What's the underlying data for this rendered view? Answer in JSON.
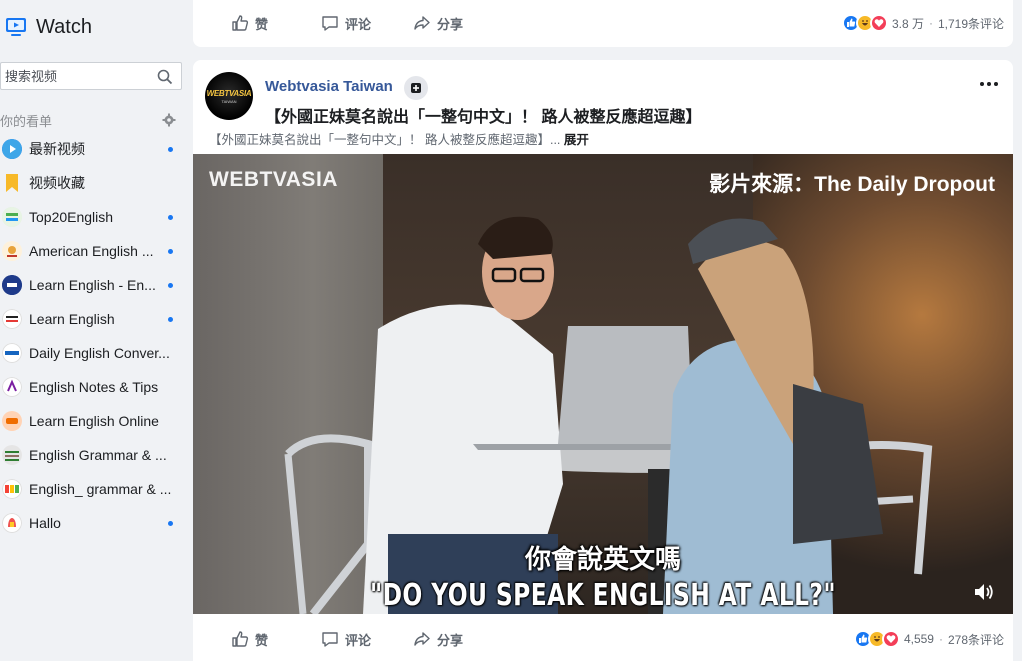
{
  "sidebar": {
    "title": "Watch",
    "search_placeholder": "搜索视频",
    "section_label": "你的看单",
    "items": [
      {
        "label": "最新视频",
        "icon": "play-icon",
        "unread": true
      },
      {
        "label": "视频收藏",
        "icon": "bookmark-icon",
        "unread": false
      },
      {
        "label": "Top20English",
        "icon": "page-avatar",
        "unread": true
      },
      {
        "label": "American English ...",
        "icon": "page-avatar",
        "unread": true
      },
      {
        "label": "Learn English - En...",
        "icon": "page-avatar",
        "unread": true
      },
      {
        "label": "Learn English",
        "icon": "page-avatar",
        "unread": true
      },
      {
        "label": "Daily English Conver...",
        "icon": "page-avatar",
        "unread": false
      },
      {
        "label": "English Notes & Tips",
        "icon": "page-avatar",
        "unread": false
      },
      {
        "label": "Learn English Online",
        "icon": "page-avatar",
        "unread": false
      },
      {
        "label": "English Grammar & ...",
        "icon": "page-avatar",
        "unread": false
      },
      {
        "label": "English_ grammar & ...",
        "icon": "page-avatar",
        "unread": false
      },
      {
        "label": "Hallo",
        "icon": "page-avatar",
        "unread": true
      }
    ]
  },
  "top_post": {
    "like_label": "赞",
    "comment_label": "评论",
    "share_label": "分享",
    "reaction_count": "3.8 万",
    "comment_count": "1,719条评论"
  },
  "post": {
    "page_name": "Webtvasia Taiwan",
    "avatar_logo": "WEBTVASIA",
    "avatar_sub": "TAIWAN",
    "title": "【外國正妹莫名說出「一整句中文」！ 路人被整反應超逗趣】",
    "description": "【外國正妹莫名說出「一整句中文」！ 路人被整反應超逗趣】...",
    "see_more": "展开",
    "video": {
      "watermark": "WEBTVASIA",
      "source": "影片來源：The Daily Dropout",
      "subtitle_cn": "你會說英文嗎",
      "subtitle_en": "\"DO YOU SPEAK ENGLISH AT ALL?\""
    },
    "like_label": "赞",
    "comment_label": "评论",
    "share_label": "分享",
    "reaction_count": "4,559",
    "comment_count": "278条评论"
  },
  "colors": {
    "accent": "#1877f2",
    "page_name": "#365899",
    "like": "#1877f2",
    "haha": "#f7b928",
    "love": "#f33e58"
  }
}
